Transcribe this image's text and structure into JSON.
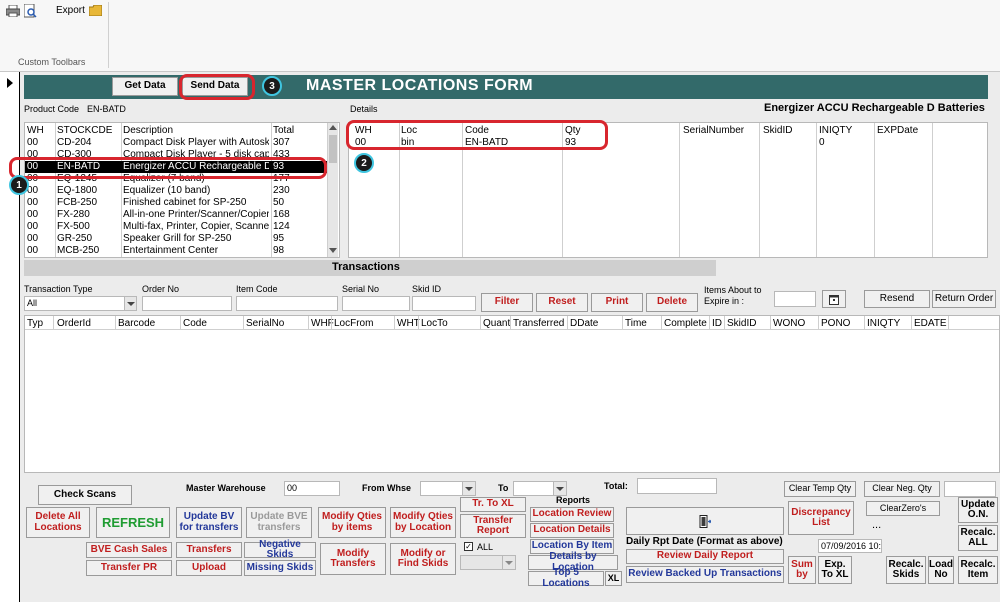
{
  "toolbar": {
    "export_label": "Export",
    "section_label": "Custom Toolbars"
  },
  "form": {
    "title": "MASTER LOCATIONS FORM",
    "get_data": "Get Data",
    "send_data": "Send Data",
    "product_code_label": "Product Code",
    "product_code": "EN-BATD",
    "details_label": "Details",
    "product_name": "Energizer ACCU Rechargeable D Batteries"
  },
  "markers": [
    "1",
    "2",
    "3"
  ],
  "stock": {
    "headers": [
      "WH",
      "STOCKCDE",
      "Description",
      "Total"
    ],
    "rows": [
      [
        "00",
        "CD-204",
        "Compact Disk Player with Autosk",
        "307"
      ],
      [
        "00",
        "CD-300",
        "Compact Disk Player - 5 disk capa",
        "433"
      ],
      [
        "00",
        "EN-BATD",
        "Energizer ACCU Rechargeable D",
        "93"
      ],
      [
        "00",
        "EQ-1245",
        "Equalizer (7 band)",
        "177"
      ],
      [
        "00",
        "EQ-1800",
        "Equalizer (10 band)",
        "230"
      ],
      [
        "00",
        "FCB-250",
        "Finished cabinet for SP-250",
        "50"
      ],
      [
        "00",
        "FX-280",
        "All-in-one Printer/Scanner/Copier",
        "168"
      ],
      [
        "00",
        "FX-500",
        "Multi-fax, Printer, Copier, Scanne",
        "124"
      ],
      [
        "00",
        "GR-250",
        "Speaker Grill for SP-250",
        "95"
      ],
      [
        "00",
        "MCB-250",
        "Entertainment Center",
        "98"
      ]
    ]
  },
  "details": {
    "headers": [
      "WH",
      "Loc",
      "Code",
      "Qty",
      "SerialNumber",
      "SkidID",
      "INIQTY",
      "EXPDate"
    ],
    "row": [
      "00",
      "bin",
      "EN-BATD",
      "93",
      "",
      "",
      "0",
      ""
    ]
  },
  "transactions": {
    "title": "Transactions",
    "type_label": "Transaction Type",
    "type_value": "All",
    "order_no_label": "Order No",
    "item_code_label": "Item Code",
    "serial_no_label": "Serial No",
    "skid_id_label": "Skid ID",
    "filter": "Filter",
    "reset": "Reset",
    "print": "Print",
    "delete": "Delete",
    "expire_label_1": "Items About to",
    "expire_label_2": "Expire in :",
    "resend": "Resend",
    "return_order": "Return Order",
    "headers": [
      "Typ",
      "OrderId",
      "Barcode",
      "Code",
      "SerialNo",
      "WHF",
      "LocFrom",
      "WHT",
      "LocTo",
      "Quant",
      "Transferred",
      "DDate",
      "Time",
      "Complete",
      "ID",
      "SkidID",
      "WONO",
      "PONO",
      "INIQTY",
      "EDATE"
    ]
  },
  "bottom": {
    "check_scans": "Check Scans",
    "master_warehouse_label": "Master Warehouse",
    "master_warehouse": "00",
    "from_whse_label": "From Whse",
    "to_label": "To",
    "total_label": "Total:",
    "reports_label": "Reports",
    "clear_temp_qty": "Clear Temp Qty",
    "clear_neg_qty": "Clear Neg. Qty",
    "delete_all_locations": "Delete All Locations",
    "refresh": "REFRESH",
    "update_bv": "Update BV for transfers",
    "update_bve": "Update BVE transfers",
    "modify_qties_items": "Modify Qties by items",
    "modify_qties_location": "Modify Qties by Location",
    "tr_to_xl": "Tr. To XL",
    "transfer_report": "Transfer Report",
    "location_review": "Location Review",
    "location_details": "Location Details",
    "location_by_item": "Location By Item",
    "details_by_location": "Details by Location",
    "top5_locations": "Top 5 Locations",
    "xl": "XL",
    "discrepancy_list": "Discrepancy List",
    "clear_zeros": "ClearZero's",
    "ellipsis": "...",
    "update_on": "Update O.N.",
    "recalc_all": "Recalc. ALL",
    "bve_cash_sales": "BVE Cash Sales",
    "transfers": "Transfers",
    "negative_skids": "Negative Skids",
    "modify_transfers": "Modify Transfers",
    "modify_find_skids": "Modify or Find Skids",
    "all_checkbox": "ALL",
    "daily_rpt_date": "Daily Rpt Date (Format as above)",
    "review_daily_report": "Review Daily Report",
    "review_backed_up": "Review Backed Up Transactions",
    "date_value": "07/09/2016 10:",
    "transfer_pr": "Transfer PR",
    "upload": "Upload",
    "missing_skids": "Missing Skids",
    "sum_by": "Sum by",
    "exp_to_xl": "Exp. To XL",
    "recalc_skids": "Recalc. Skids",
    "load_no": "Load No",
    "recalc_item": "Recalc. Item"
  }
}
